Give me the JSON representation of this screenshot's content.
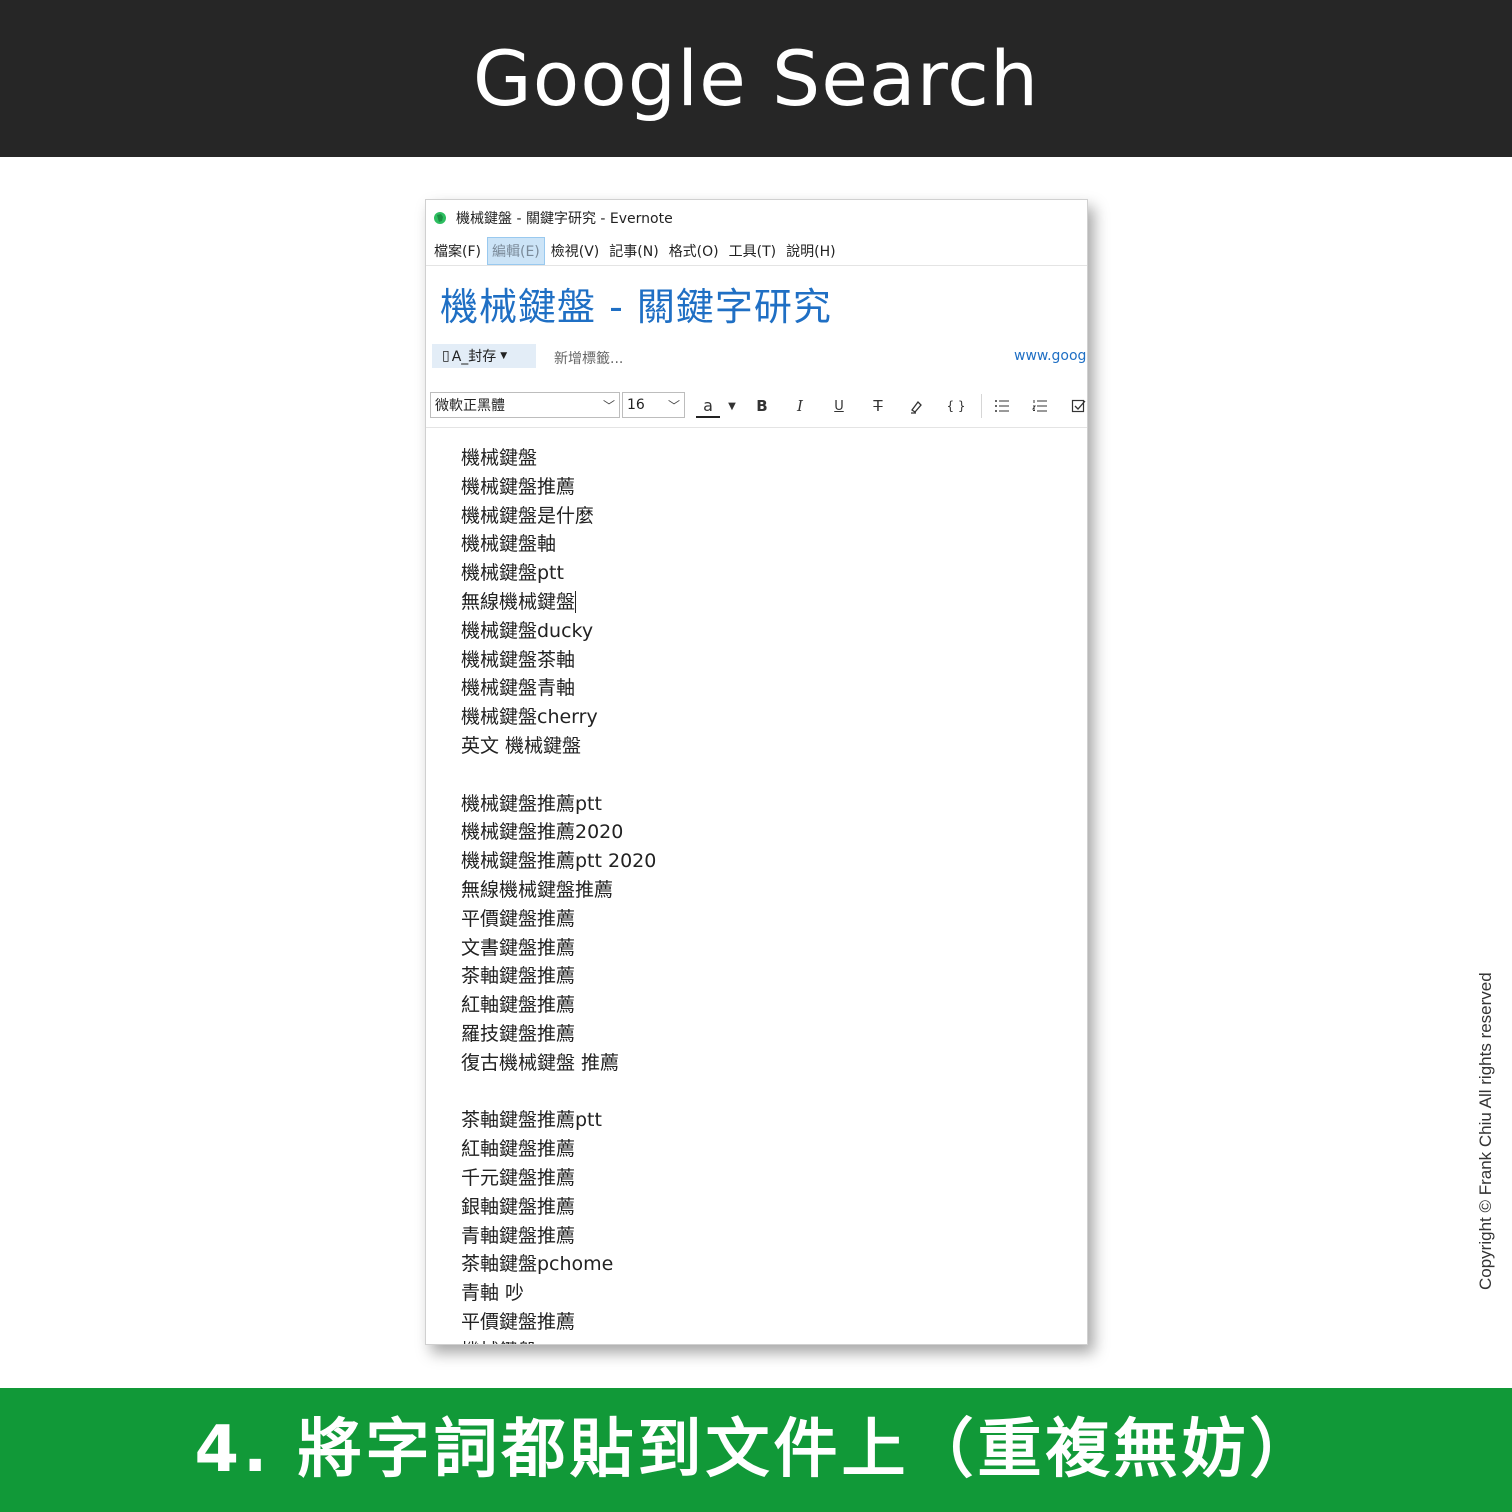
{
  "banner": {
    "title": "Google Search",
    "caption": "4. 將字詞都貼到文件上（重複無妨）"
  },
  "copyright": "Copyright © Frank Chiu All rights reserved",
  "colors": {
    "top_banner": "#262626",
    "bottom_banner": "#119938",
    "note_title": "#1f6fc4",
    "menu_highlight": "#cce4f7"
  },
  "window": {
    "title": "機械鍵盤 - 關鍵字研究 - Evernote",
    "app_icon": "evernote-elephant-icon"
  },
  "menubar": [
    {
      "label": "檔案(F)",
      "active": false
    },
    {
      "label": "編輯(E)",
      "active": true
    },
    {
      "label": "檢視(V)",
      "active": false
    },
    {
      "label": "記事(N)",
      "active": false
    },
    {
      "label": "格式(O)",
      "active": false
    },
    {
      "label": "工具(T)",
      "active": false
    },
    {
      "label": "說明(H)",
      "active": false
    }
  ],
  "note": {
    "title": "機械鍵盤 - 關鍵字研究",
    "notebook": "A_封存",
    "tag_placeholder": "新增標籤...",
    "source_url": "www.goog"
  },
  "toolbar": {
    "font": "微軟正黑體",
    "size": "16",
    "color_label": "a",
    "bold": "B",
    "italic": "I",
    "underline": "U",
    "strike": "T",
    "highlight_icon": "highlighter-icon",
    "code": "{ }",
    "bullet_icon": "bulleted-list-icon",
    "numbered_icon": "numbered-list-icon",
    "checkbox_icon": "checkbox-icon"
  },
  "lines": [
    "機械鍵盤",
    "機械鍵盤推薦",
    "機械鍵盤是什麼",
    "機械鍵盤軸",
    "機械鍵盤ptt",
    "無線機械鍵盤",
    "機械鍵盤ducky",
    "機械鍵盤茶軸",
    "機械鍵盤青軸",
    "機械鍵盤cherry",
    "英文 機械鍵盤",
    "",
    "機械鍵盤推薦ptt",
    "機械鍵盤推薦2020",
    "機械鍵盤推薦ptt 2020",
    "無線機械鍵盤推薦",
    "平價鍵盤推薦",
    "文書鍵盤推薦",
    "茶軸鍵盤推薦",
    "紅軸鍵盤推薦",
    "羅技鍵盤推薦",
    "復古機械鍵盤 推薦",
    "",
    "茶軸鍵盤推薦ptt",
    "紅軸鍵盤推薦",
    "千元鍵盤推薦",
    "銀軸鍵盤推薦",
    "青軸鍵盤推薦",
    "茶軸鍵盤pchome",
    "青軸 吵",
    "平價鍵盤推薦",
    "機械鍵盤"
  ]
}
